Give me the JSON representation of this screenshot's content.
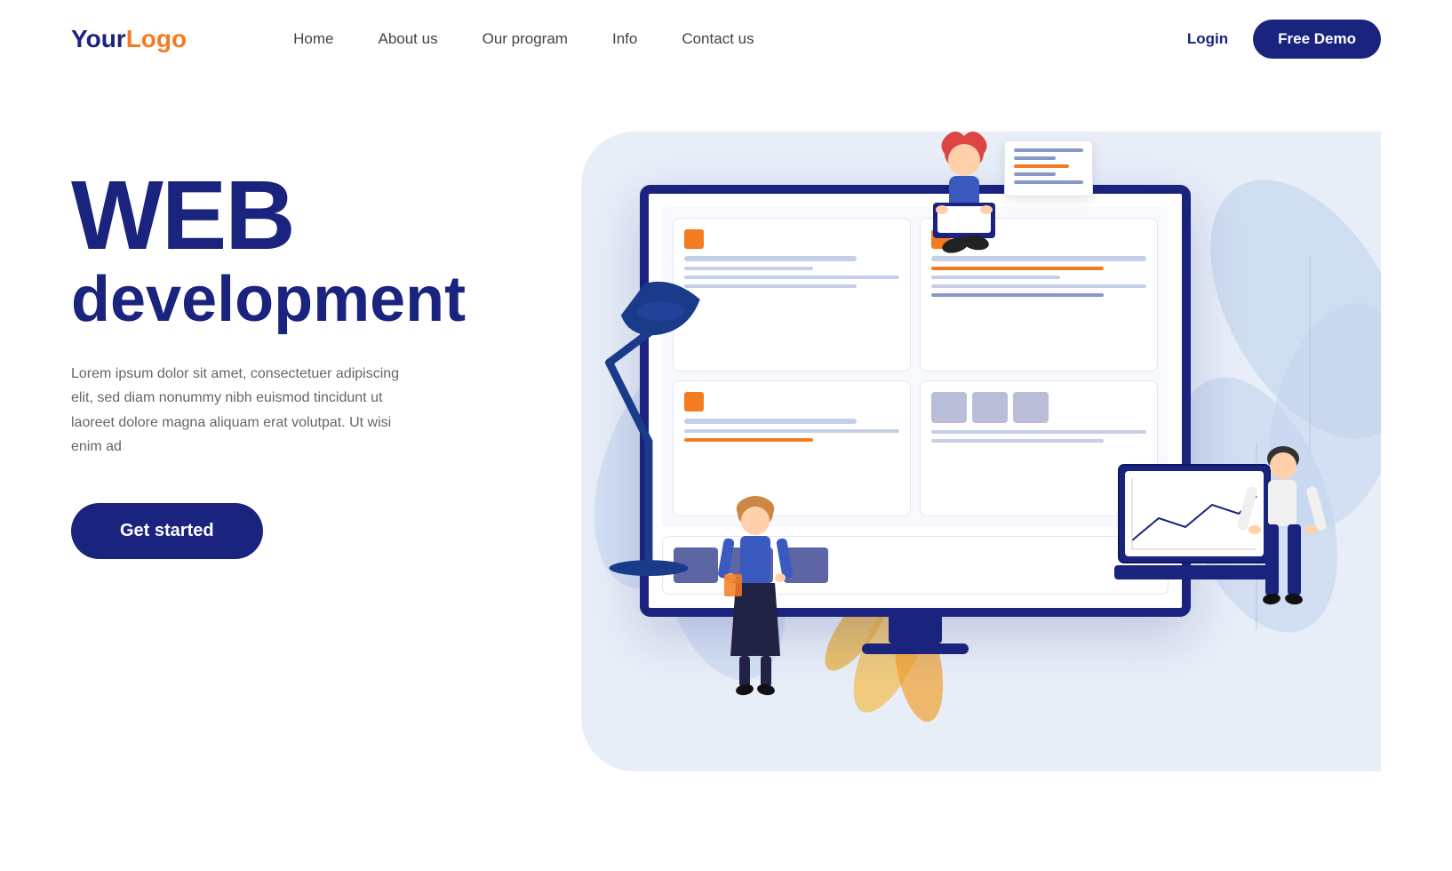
{
  "logo": {
    "your": "Your",
    "logo": "Logo"
  },
  "nav": {
    "links": [
      {
        "label": "Home",
        "id": "nav-home"
      },
      {
        "label": "About us",
        "id": "nav-about"
      },
      {
        "label": "Our program",
        "id": "nav-program"
      },
      {
        "label": "Info",
        "id": "nav-info"
      },
      {
        "label": "Contact us",
        "id": "nav-contact"
      }
    ],
    "login_label": "Login",
    "free_demo_label": "Free Demo"
  },
  "hero": {
    "title_line1": "WEB",
    "title_line2": "development",
    "description": "Lorem ipsum dolor sit amet, consectetuer adipiscing elit, sed diam nonummy nibh euismod tincidunt ut laoreet dolore magna aliquam erat volutpat. Ut wisi enim ad",
    "cta_label": "Get started"
  },
  "colors": {
    "primary": "#1a237e",
    "accent": "#f47c20",
    "bg_blob": "#e8eef8",
    "text_muted": "#666666"
  }
}
